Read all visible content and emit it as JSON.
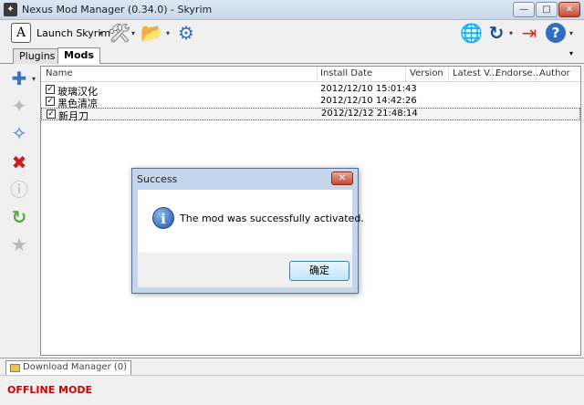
{
  "window": {
    "title": "Nexus Mod Manager (0.34.0) - Skyrim",
    "minimize_glyph": "—",
    "maximize_glyph": "□",
    "close_glyph": "✕"
  },
  "toolbar": {
    "launch_label": "Launch Skyrim",
    "dropdown_glyph": "▾"
  },
  "tabs": [
    {
      "label": "Plugins"
    },
    {
      "label": "Mods"
    }
  ],
  "mods_table": {
    "columns": [
      "Name",
      "Install Date",
      "Version",
      "Latest V...",
      "Endorse...",
      "Author"
    ],
    "rows": [
      {
        "name": "玻璃汉化",
        "install_date": "2012/12/10 15:01:43",
        "checked": true
      },
      {
        "name": "黑色清凉",
        "install_date": "2012/12/10 14:42:26",
        "checked": true
      },
      {
        "name": "新月刀",
        "install_date": "2012/12/12 21:48:14",
        "checked": true
      }
    ],
    "check_glyph": "✓"
  },
  "dialog": {
    "title": "Success",
    "close_glyph": "✕",
    "message": "The mod was successfully activated.",
    "ok_label": "确定"
  },
  "download_manager": {
    "tab_label": "Download Manager (0)"
  },
  "status": {
    "mode": "OFFLINE MODE",
    "mode_color": "#d00000"
  },
  "icons": {
    "app": "nexus-logo-icon",
    "tools": "tools-icon",
    "folder": "open-folder-icon",
    "settings": "gear-icon",
    "online": "globe-network-icon",
    "refresh": "refresh-icon",
    "logout": "logout-icon",
    "help": "help-icon"
  }
}
